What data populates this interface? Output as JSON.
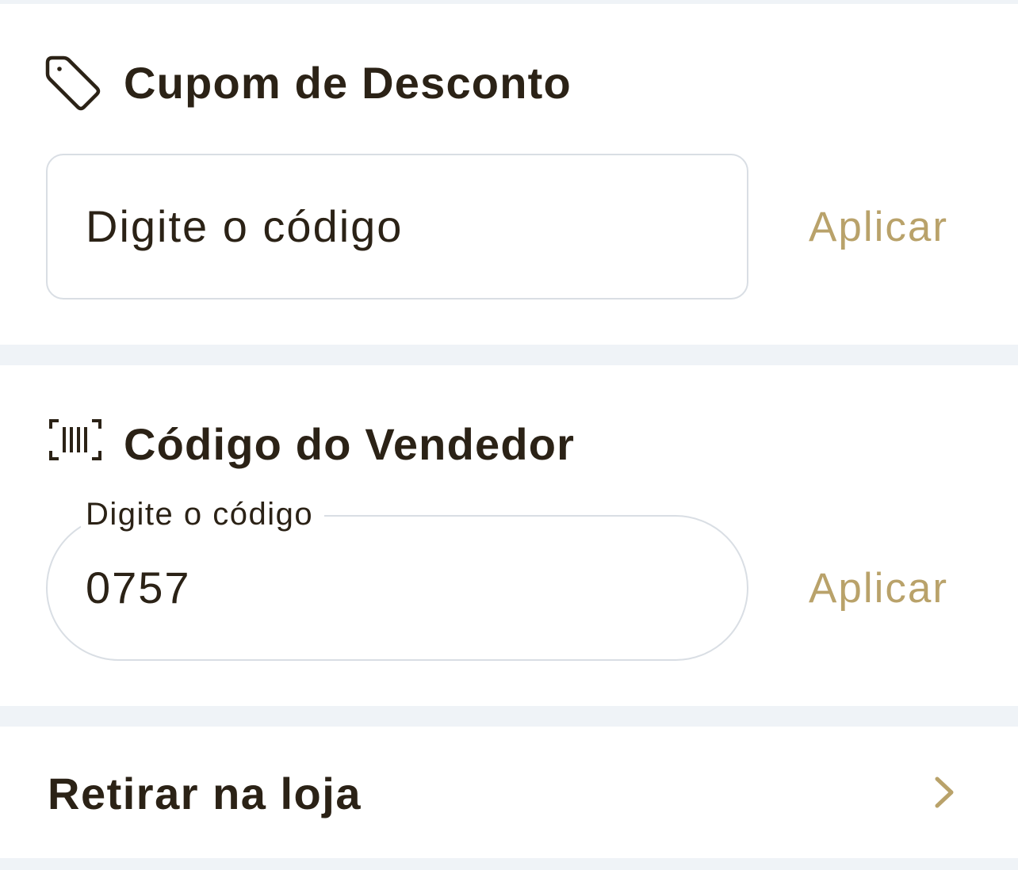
{
  "colors": {
    "accent": "#b9a26a",
    "text": "#2b2216",
    "border": "#d9dee4",
    "background": "#eff3f7",
    "card": "#ffffff"
  },
  "coupon": {
    "icon": "tag-icon",
    "title": "Cupom de Desconto",
    "input_placeholder": "Digite o código",
    "apply_label": "Aplicar"
  },
  "seller": {
    "icon": "barcode-scan-icon",
    "title": "Código do Vendedor",
    "input_label": "Digite o código",
    "input_value": "0757",
    "apply_label": "Aplicar"
  },
  "pickup": {
    "label": "Retirar na loja",
    "icon": "chevron-right-icon"
  }
}
